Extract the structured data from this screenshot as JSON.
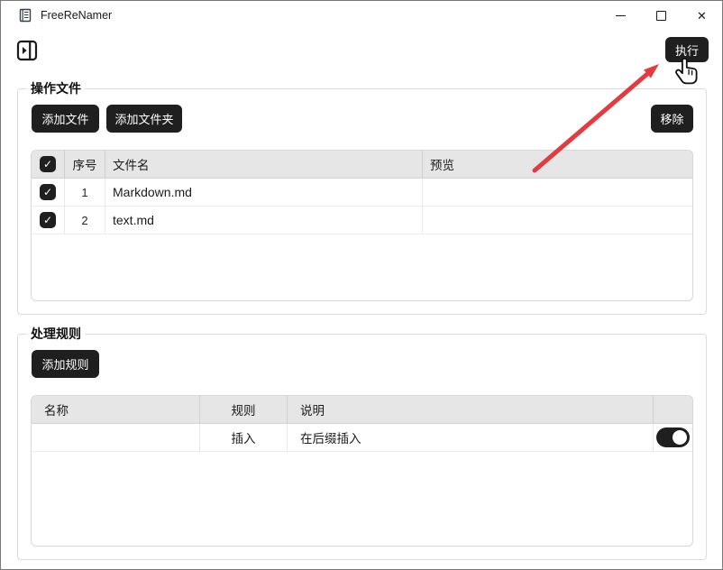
{
  "window": {
    "title": "FreeReNamer",
    "controls": {
      "minimize": "─",
      "maximize": "□",
      "close": "✕"
    }
  },
  "toolbar": {
    "execute_label": "执行",
    "sidebar_toggle_icon": "panel-expand-right"
  },
  "icons": {
    "check": "✓"
  },
  "colors": {
    "button_dark": "#1f1f1f",
    "table_header_bg": "#e6e6e6",
    "group_border": "#dcdcdc",
    "annotation_arrow": "#e23b40"
  },
  "files_section": {
    "title": "操作文件",
    "add_file_label": "添加文件",
    "add_folder_label": "添加文件夹",
    "remove_label": "移除",
    "table": {
      "headers": {
        "index": "序号",
        "filename": "文件名",
        "preview": "预览"
      },
      "rows": [
        {
          "checked": true,
          "index": "1",
          "filename": "Markdown.md",
          "preview": ""
        },
        {
          "checked": true,
          "index": "2",
          "filename": "text.md",
          "preview": ""
        }
      ]
    }
  },
  "rules_section": {
    "title": "处理规则",
    "add_rule_label": "添加规则",
    "table": {
      "headers": {
        "name": "名称",
        "rule": "规则",
        "description": "说明"
      },
      "rows": [
        {
          "name": "",
          "rule": "插入",
          "description": "在后缀插入",
          "enabled": true
        }
      ]
    }
  }
}
